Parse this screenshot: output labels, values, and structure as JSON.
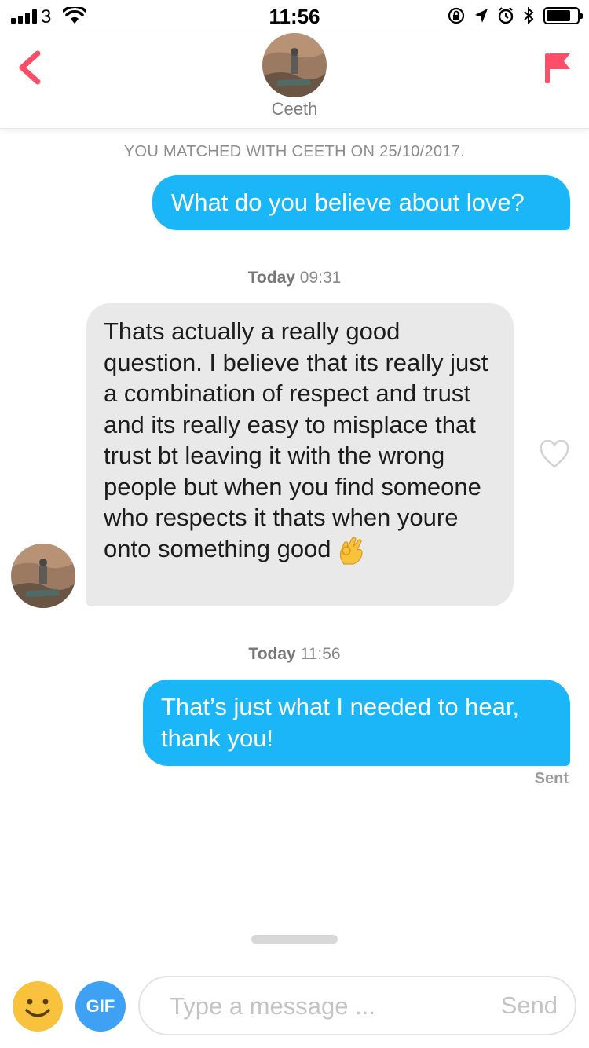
{
  "status_bar": {
    "carrier": "3",
    "time": "11:56",
    "battery_level": 0.8,
    "icons": [
      "signal-icon",
      "wifi-icon",
      "orientation-lock-icon",
      "location-arrow-icon",
      "alarm-icon",
      "bluetooth-icon",
      "battery-icon"
    ]
  },
  "header": {
    "match_name": "Ceeth",
    "back_icon": "chevron-left-icon",
    "report_icon": "flag-icon"
  },
  "chat": {
    "match_banner": "YOU MATCHED WITH CEETH ON 25/10/2017.",
    "messages": [
      {
        "direction": "outgoing",
        "text": "What do you believe about love?"
      },
      {
        "direction": "timestamp",
        "day": "Today",
        "time": "09:31"
      },
      {
        "direction": "incoming",
        "text": "Thats actually a really good question. I believe that its really just a combination of respect and trust and its really easy to misplace that trust bt leaving it with the wrong people but when you find someone who respects it thats when youre onto something good",
        "emoji": "ok-hand-emoji"
      },
      {
        "direction": "timestamp",
        "day": "Today",
        "time": "11:56"
      },
      {
        "direction": "outgoing",
        "text": "That’s just what I needed to hear, thank you!",
        "status": "Sent"
      }
    ]
  },
  "composer": {
    "emoji_button_icon": "smiley-face-icon",
    "gif_label": "GIF",
    "placeholder": "Type a message ...",
    "value": "",
    "send_label": "Send"
  },
  "colors": {
    "outgoing_bubble": "#1bb6f7",
    "incoming_bubble": "#e9e9e9",
    "accent_red": "#fd4d68",
    "gif_blue": "#3ea1f3",
    "emoji_yellow": "#f9c23c"
  }
}
